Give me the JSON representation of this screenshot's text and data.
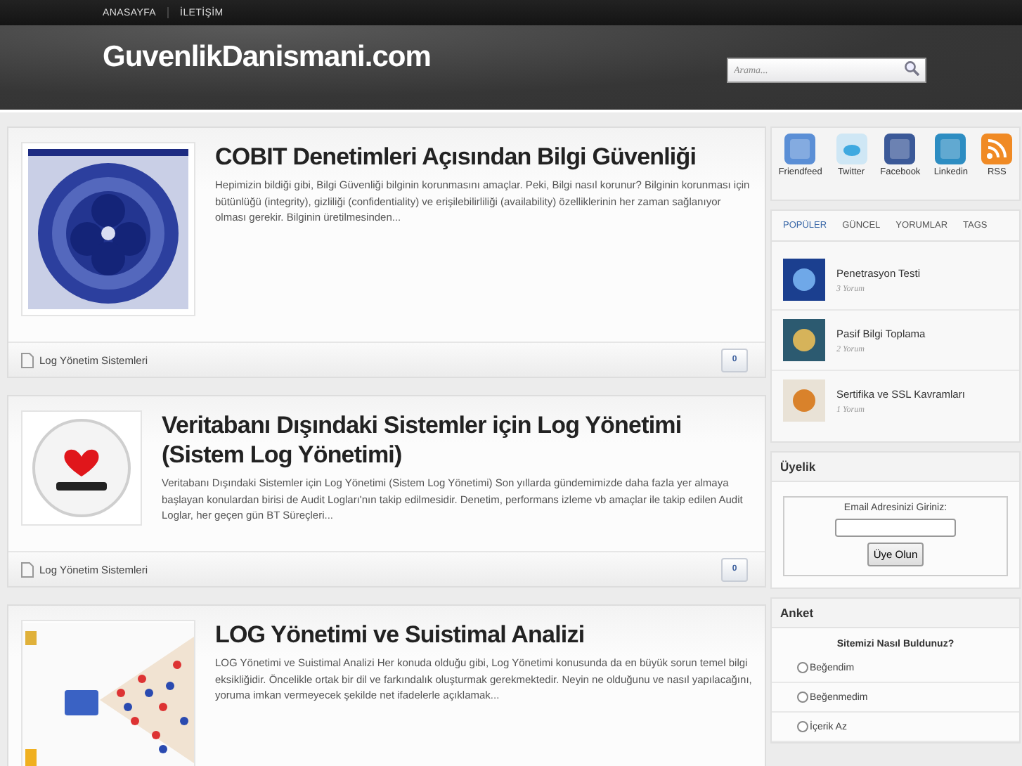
{
  "nav": [
    "ANASAYFA",
    "İLETİŞİM"
  ],
  "site_title": "GuvenlikDanismani.com",
  "search": {
    "placeholder": "Arama..."
  },
  "posts": [
    {
      "title": "COBIT Denetimleri Açısından Bilgi Güvenliği",
      "excerpt": " Hepimizin bildiği gibi, Bilgi Güvenliği bilginin korunmasını amaçlar. Peki, Bilgi nasıl korunur? Bilginin korunması için bütünlüğü (integrity), gizliliği (confidentiality) ve erişilebilirliliği (availability) özelliklerinin her zaman sağlanıyor olması gerekir. Bilginin üretilmesinden...",
      "kind": "diagram",
      "category": "Log Yönetim Sistemleri",
      "comments": "0"
    },
    {
      "title": "Veritabanı Dışındaki Sistemler için Log Yönetimi (Sistem Log Yönetimi)",
      "excerpt": "Veritabanı Dışındaki Sistemler için Log Yönetimi (Sistem Log Yönetimi) Son yıllarda gündemimizde daha fazla yer almaya başlayan konulardan birisi de Audit Logları'nın takip edilmesidir. Denetim, performans izleme vb amaçlar ile takip edilen Audit Loglar, her geçen gün BT Süreçleri...",
      "kind": "badge",
      "category": "Log Yönetim Sistemleri",
      "comments": "0"
    },
    {
      "title": "LOG Yönetimi ve Suistimal Analizi",
      "excerpt": "LOG Yönetimi ve Suistimal Analizi Her konuda olduğu gibi, Log Yönetimi konusunda da en büyük sorun temel bilgi eksikliğidir. Öncelikle ortak bir dil ve farkındalık oluşturmak gerekmektedir. Neyin ne olduğunu ve nasıl yapılacağını, yoruma imkan vermeyecek şekilde net ifadelerle açıklamak...",
      "kind": "flow"
    }
  ],
  "social": [
    {
      "label": "Friendfeed",
      "kind": "friendfeed"
    },
    {
      "label": "Twitter",
      "kind": "twitter"
    },
    {
      "label": "Facebook",
      "kind": "facebook"
    },
    {
      "label": "Linkedin",
      "kind": "linkedin"
    },
    {
      "label": "RSS",
      "kind": "rss"
    }
  ],
  "tabs": [
    {
      "label": "POPÜLER",
      "selected": true
    },
    {
      "label": "GÜNCEL",
      "selected": false
    },
    {
      "label": "YORUMLAR",
      "selected": false
    },
    {
      "label": "TAGS",
      "selected": false
    }
  ],
  "popular": [
    {
      "title": "Penetrasyon Testi",
      "comments": "3 Yorum",
      "kind": "blue"
    },
    {
      "title": "Pasif Bilgi Toplama",
      "comments": "2 Yorum",
      "kind": "teal"
    },
    {
      "title": "Sertifika ve SSL Kavramları",
      "comments": "1 Yorum",
      "kind": "orange"
    }
  ],
  "membership": {
    "title": "Üyelik",
    "prompt": "Email Adresinizi Giriniz:",
    "button": "Üye Olun"
  },
  "poll": {
    "title": "Anket",
    "question": "Sitemizi Nasıl Buldunuz?",
    "options": [
      {
        "label": "Beğendim",
        "selected": false
      },
      {
        "label": "Beğenmedim",
        "selected": false
      },
      {
        "label": "İçerik Az",
        "selected": false
      }
    ]
  }
}
